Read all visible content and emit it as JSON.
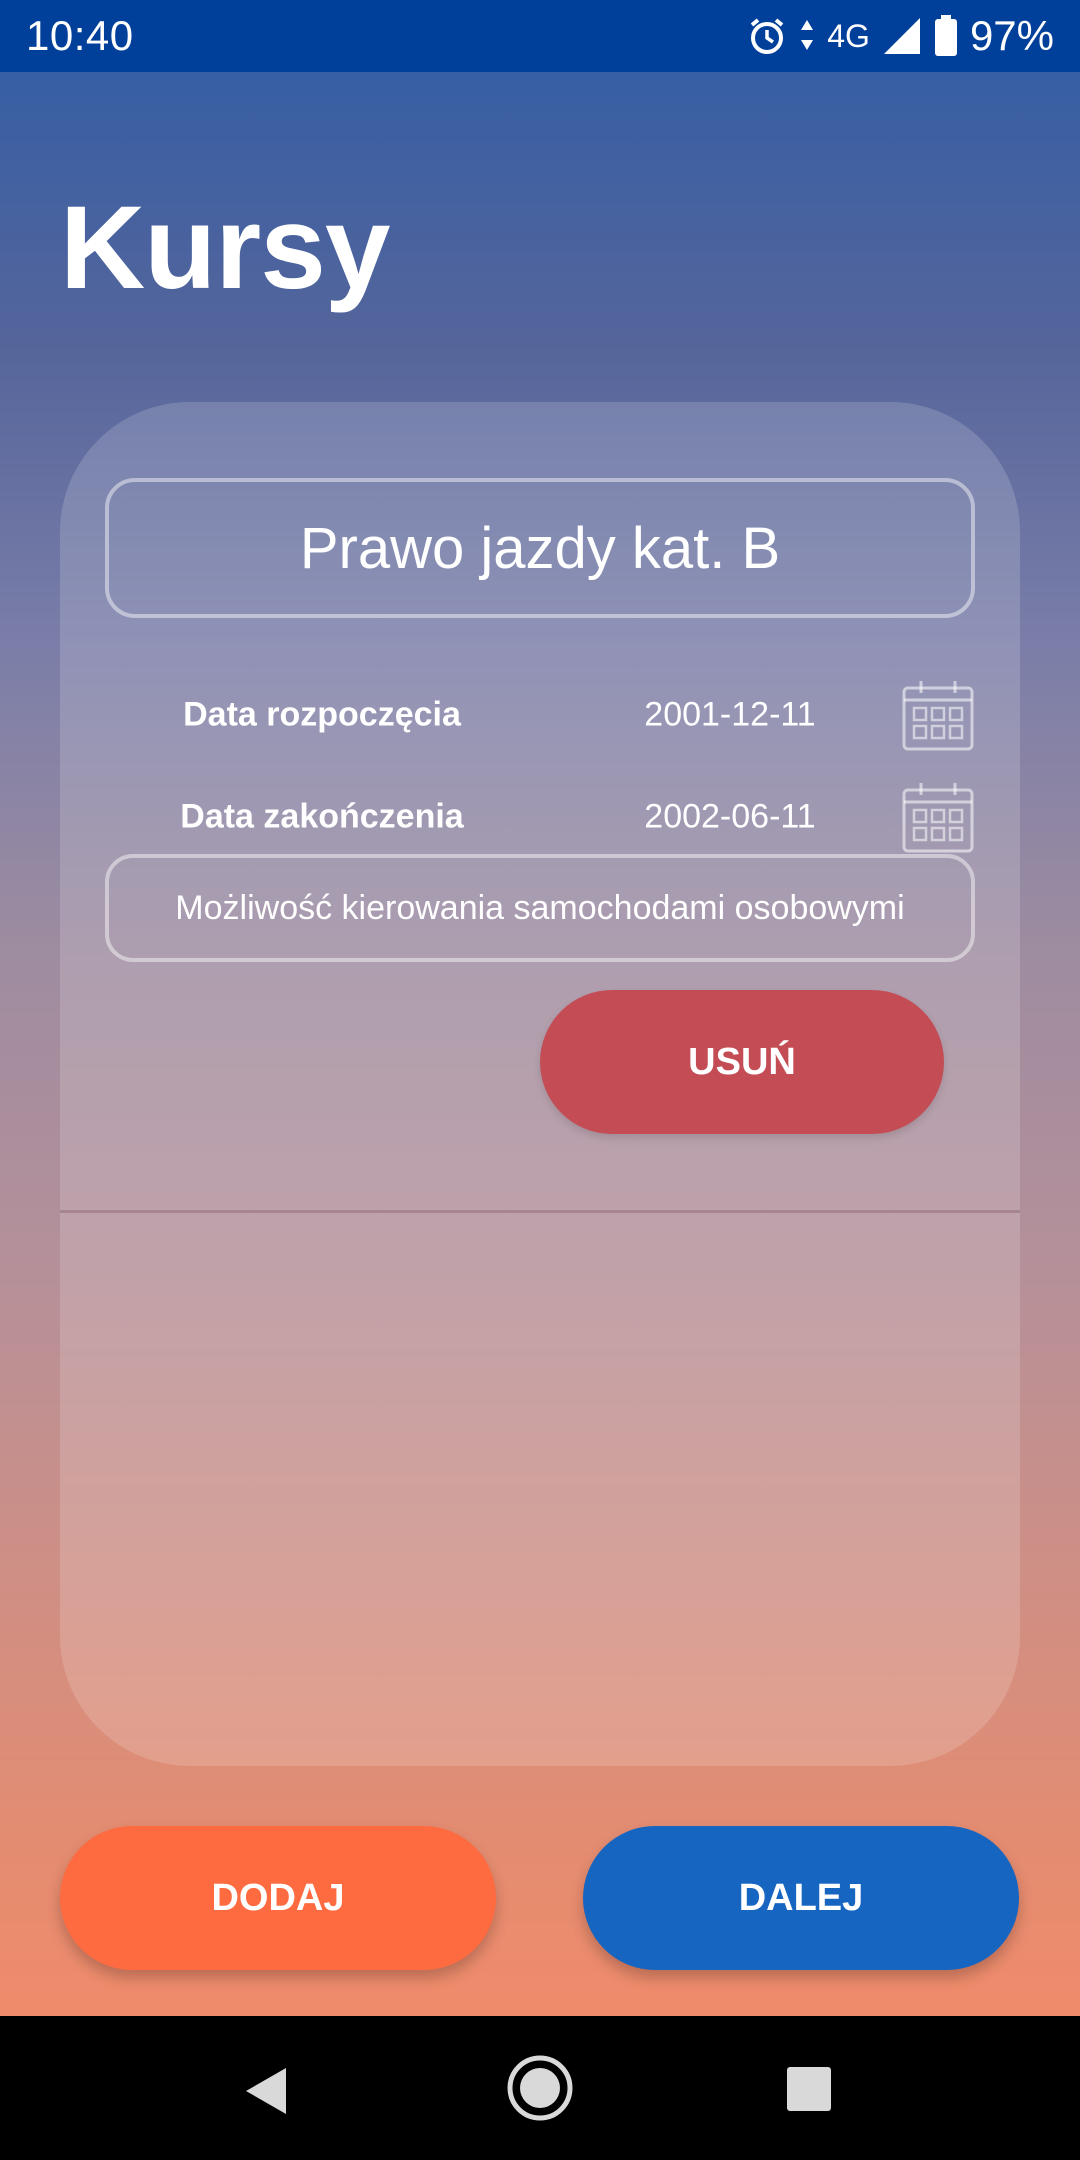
{
  "status_bar": {
    "time": "10:40",
    "network": "4G",
    "battery": "97%",
    "icons": [
      "alarm-icon",
      "data-arrows-icon",
      "signal-icon",
      "battery-icon"
    ]
  },
  "page": {
    "title": "Kursy"
  },
  "course": {
    "name": "Prawo jazdy kat. B",
    "start_label": "Data rozpoczęcia",
    "start_value": "2001-12-11",
    "end_label": "Data zakończenia",
    "end_value": "2002-06-11",
    "description": "Możliwość kierowania samochodami osobowymi",
    "delete_label": "USUŃ"
  },
  "actions": {
    "add_label": "DODAJ",
    "next_label": "DALEJ"
  },
  "colors": {
    "status_bar": "#003f9a",
    "delete": "#c44d55",
    "add": "#ff6b40",
    "next": "#1665c1"
  },
  "nav": {
    "icons": [
      "back-icon",
      "home-icon",
      "recents-icon"
    ]
  }
}
